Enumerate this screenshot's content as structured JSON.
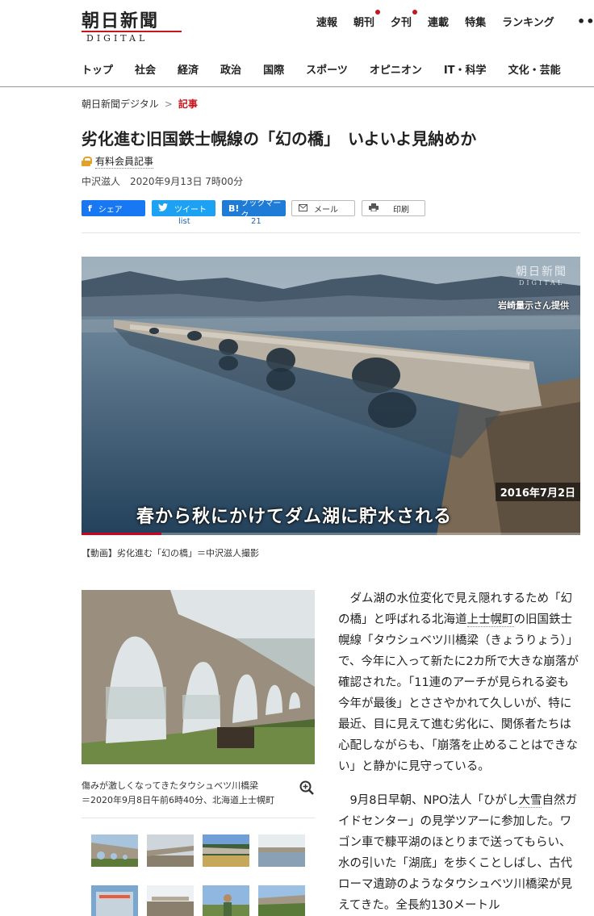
{
  "header": {
    "logo_text": "朝日新聞",
    "logo_sub": "DIGITAL",
    "topnav": [
      {
        "label": "速報",
        "dot": false
      },
      {
        "label": "朝刊",
        "dot": true
      },
      {
        "label": "夕刊",
        "dot": true
      },
      {
        "label": "連載",
        "dot": false
      },
      {
        "label": "特集",
        "dot": false
      },
      {
        "label": "ランキング",
        "dot": false
      }
    ],
    "more": "•••"
  },
  "catnav": [
    "トップ",
    "社会",
    "経済",
    "政治",
    "国際",
    "スポーツ",
    "オピニオン",
    "IT・科学",
    "文化・芸能"
  ],
  "breadcrumb": {
    "home": "朝日新聞デジタル",
    "sep": ">",
    "current": "記事"
  },
  "article": {
    "title": "劣化進む旧国鉄士幌線の「幻の橋」　いよいよ見納めか",
    "paid_label": "有料会員記事",
    "author": "中沢滋人",
    "date": "2020年9月13日 7時00分"
  },
  "share": {
    "facebook": "シェア",
    "twitter": "ツイート",
    "twitter_count": "list",
    "hatena": "ブックマーク",
    "hatena_icon": "B!",
    "hatena_count": "21",
    "mail": "メール",
    "print": "印刷"
  },
  "video": {
    "watermark": "朝日新聞",
    "watermark_sub": "DIGITAL",
    "credit": "岩崎量示さん提供",
    "date": "2016年7月2日",
    "caption": "春から秋にかけてダム湖に貯水される",
    "progress": 0.16,
    "footer_caption": "【動画】劣化進む「幻の橋」＝中沢滋人撮影"
  },
  "photo": {
    "caption_line1": "傷みが激しくなってきたタウシュベツ川橋梁",
    "caption_line2": "＝2020年9月8日午前6時40分、北海道上士幌町"
  },
  "body": {
    "p1": [
      "ダム湖の水位変化で見え隠れするため「幻の橋」と呼ばれる北海道",
      "上士幌町",
      "の旧国鉄士幌線「タウシュベツ川橋梁（きょうりょう）」で、今年に入って新たに2カ所で大きな崩落が確認された。「11連のアーチが見られる姿も今年が最後」とささやかれて久しいが、特に最近、目に見えて進む劣化に、関係者たちは心配しながらも、「崩落を止めることはできない」と静かに見守っている。"
    ],
    "p2": [
      "9月8日早朝、NPO法人「ひがし",
      "大雪",
      "自然ガイドセンター」の見学ツアーに参加した。ワゴン車で糠平湖のほとりまで送ってもらい、水の引いた「湖底」を歩くことしばし、古代ローマ遺跡のようなタウシュベツ川橋梁が見えてきた。全長約130メートル"
    ]
  }
}
